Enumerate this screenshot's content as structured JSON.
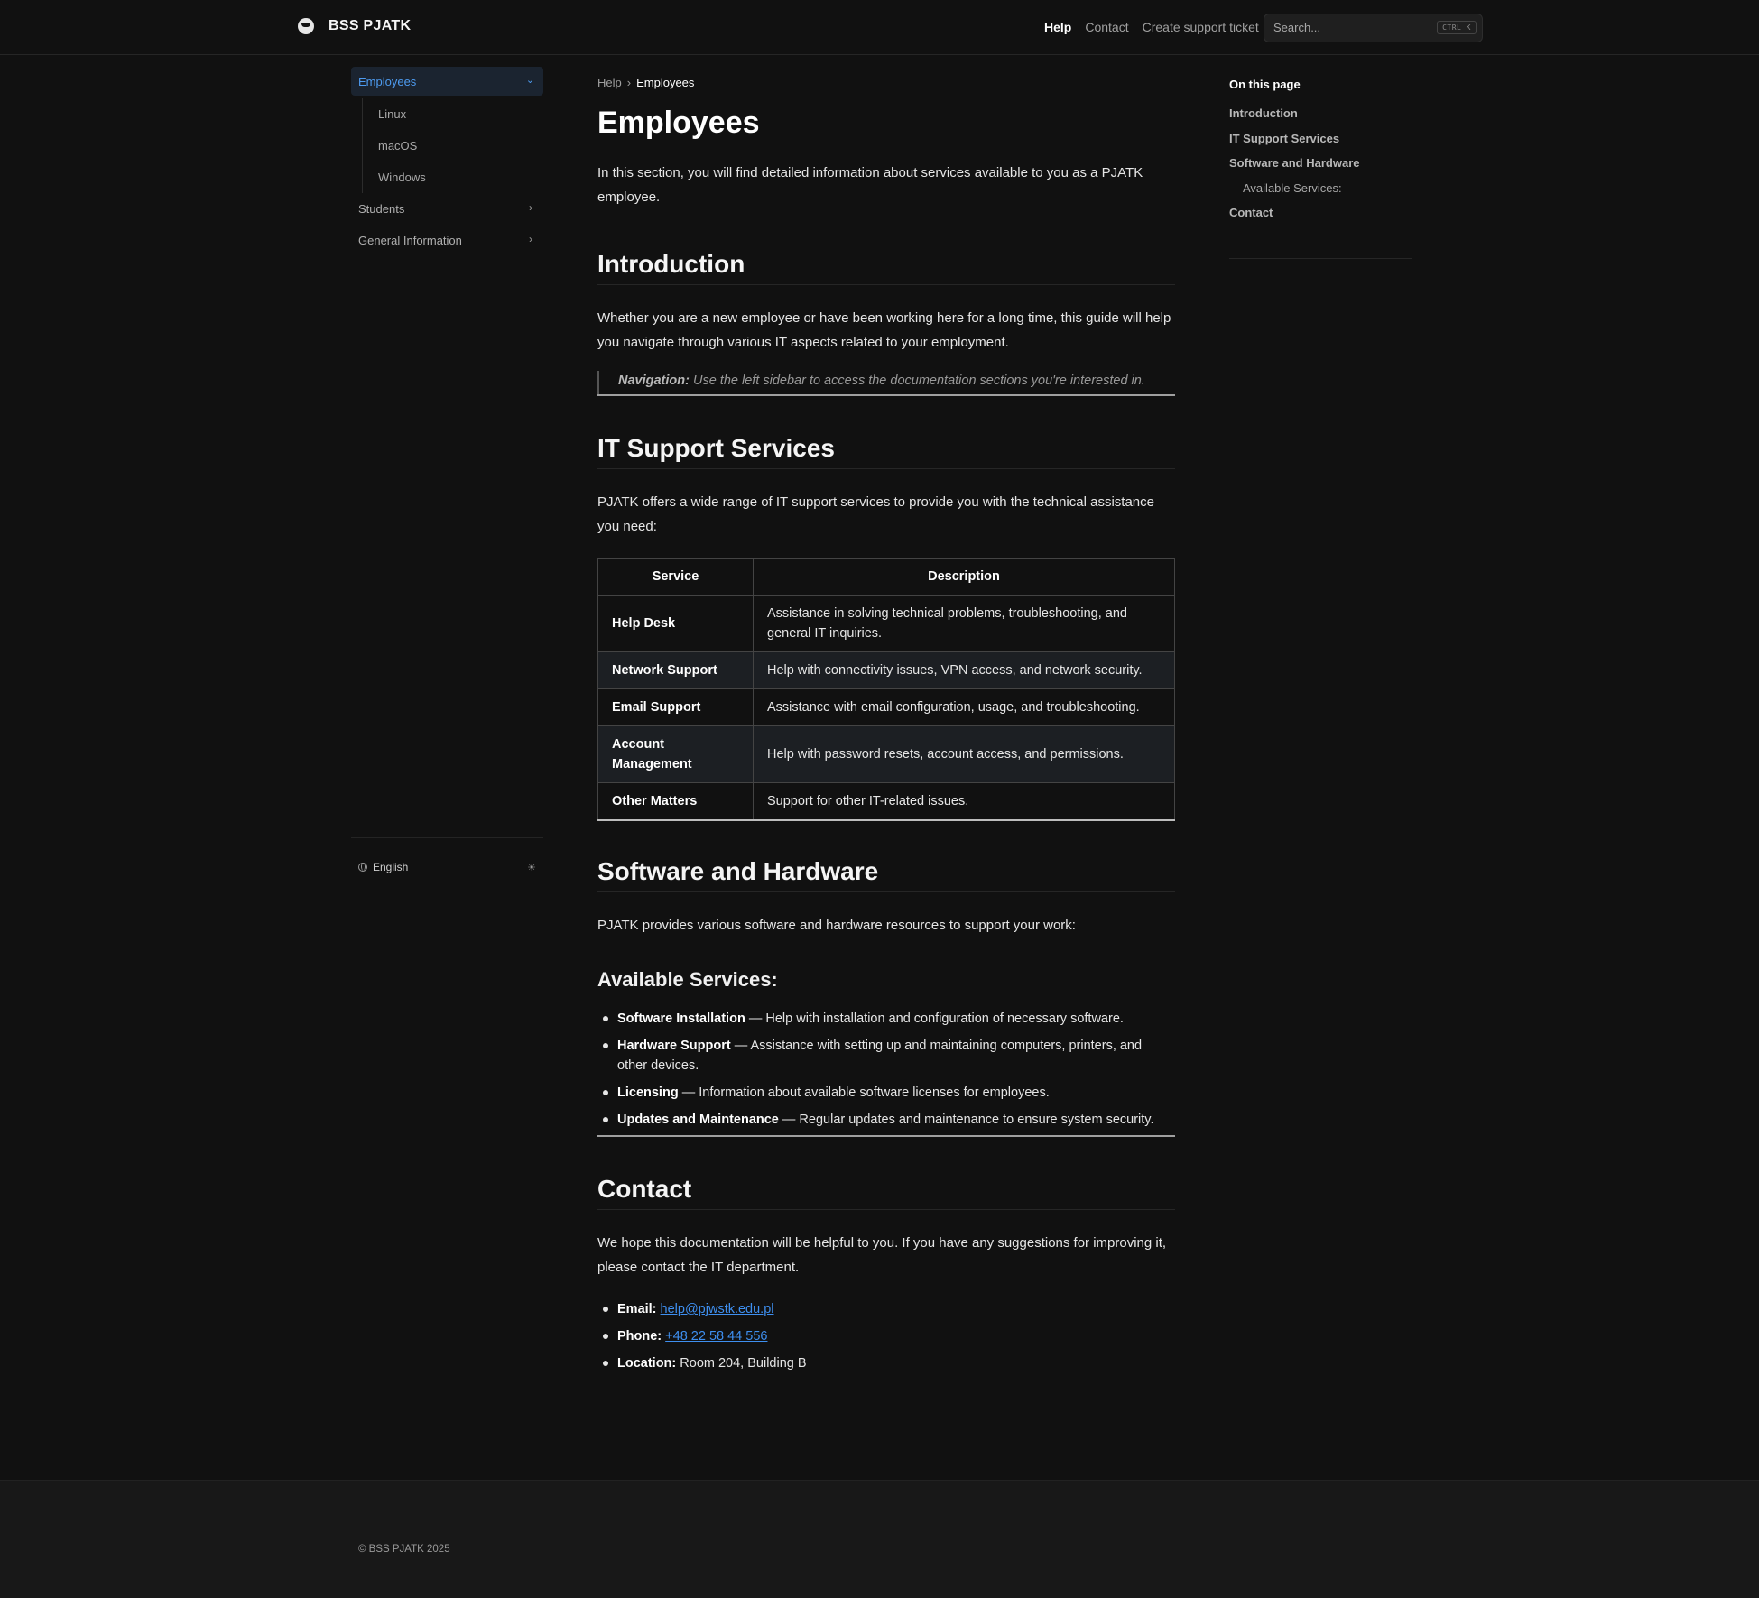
{
  "header": {
    "logo": "BSS PJATK",
    "nav": [
      {
        "label": "Help",
        "active": true
      },
      {
        "label": "Contact",
        "active": false
      },
      {
        "label": "Create support ticket",
        "active": false
      }
    ],
    "search": {
      "placeholder": "Search...",
      "shortcut": "CTRL K"
    }
  },
  "sidebar": {
    "active": "Employees",
    "subitems": [
      "Linux",
      "macOS",
      "Windows"
    ],
    "items": [
      "Students",
      "General Information"
    ],
    "language": "English"
  },
  "main": {
    "breadcrumb": {
      "root": "Help",
      "current": "Employees"
    },
    "title": "Employees",
    "intro": "In this section, you will find detailed information about services available to you as a PJATK employee.",
    "sections": {
      "introduction": {
        "heading": "Introduction",
        "text": "Whether you are a new employee or have been working here for a long time, this guide will help you navigate through various IT aspects related to your employment.",
        "note_label": "Navigation:",
        "note_text": " Use the left sidebar to access the documentation sections you're interested in."
      },
      "it_support": {
        "heading": "IT Support Services",
        "text": "PJATK offers a wide range of IT support services to provide you with the technical assistance you need:",
        "table_headers": [
          "Service",
          "Description"
        ],
        "table_rows": [
          {
            "service": "Help Desk",
            "description": "Assistance in solving technical problems, troubleshooting, and general IT inquiries."
          },
          {
            "service": "Network Support",
            "description": "Help with connectivity issues, VPN access, and network security."
          },
          {
            "service": "Email Support",
            "description": "Assistance with email configuration, usage, and troubleshooting."
          },
          {
            "service": "Account Management",
            "description": "Help with password resets, account access, and permissions."
          },
          {
            "service": "Other Matters",
            "description": "Support for other IT-related issues."
          }
        ]
      },
      "software": {
        "heading": "Software and Hardware",
        "text": "PJATK provides various software and hardware resources to support your work:",
        "subheading": "Available Services:",
        "items": [
          {
            "label": "Software Installation",
            "text": " — Help with installation and configuration of necessary software."
          },
          {
            "label": "Hardware Support",
            "text": " — Assistance with setting up and maintaining computers, printers, and other devices."
          },
          {
            "label": "Licensing",
            "text": " — Information about available software licenses for employees."
          },
          {
            "label": "Updates and Maintenance",
            "text": " — Regular updates and maintenance to ensure system security."
          }
        ]
      },
      "contact": {
        "heading": "Contact",
        "text": "We hope this documentation will be helpful to you. If you have any suggestions for improving it, please contact the IT department.",
        "email_label": "Email:",
        "email": "help@pjwstk.edu.pl",
        "phone_label": "Phone:",
        "phone": "+48 22 58 44 556",
        "location_label": "Location:",
        "location": " Room 204, Building B"
      }
    }
  },
  "toc": {
    "title": "On this page",
    "items": [
      "Introduction",
      "IT Support Services",
      "Software and Hardware",
      "Available Services:",
      "Contact"
    ]
  },
  "footer": {
    "copyright": "© BSS PJATK 2025"
  },
  "colors": {
    "background": "#111111",
    "accent": "#4d9bf0",
    "link": "#3e8ff0"
  }
}
